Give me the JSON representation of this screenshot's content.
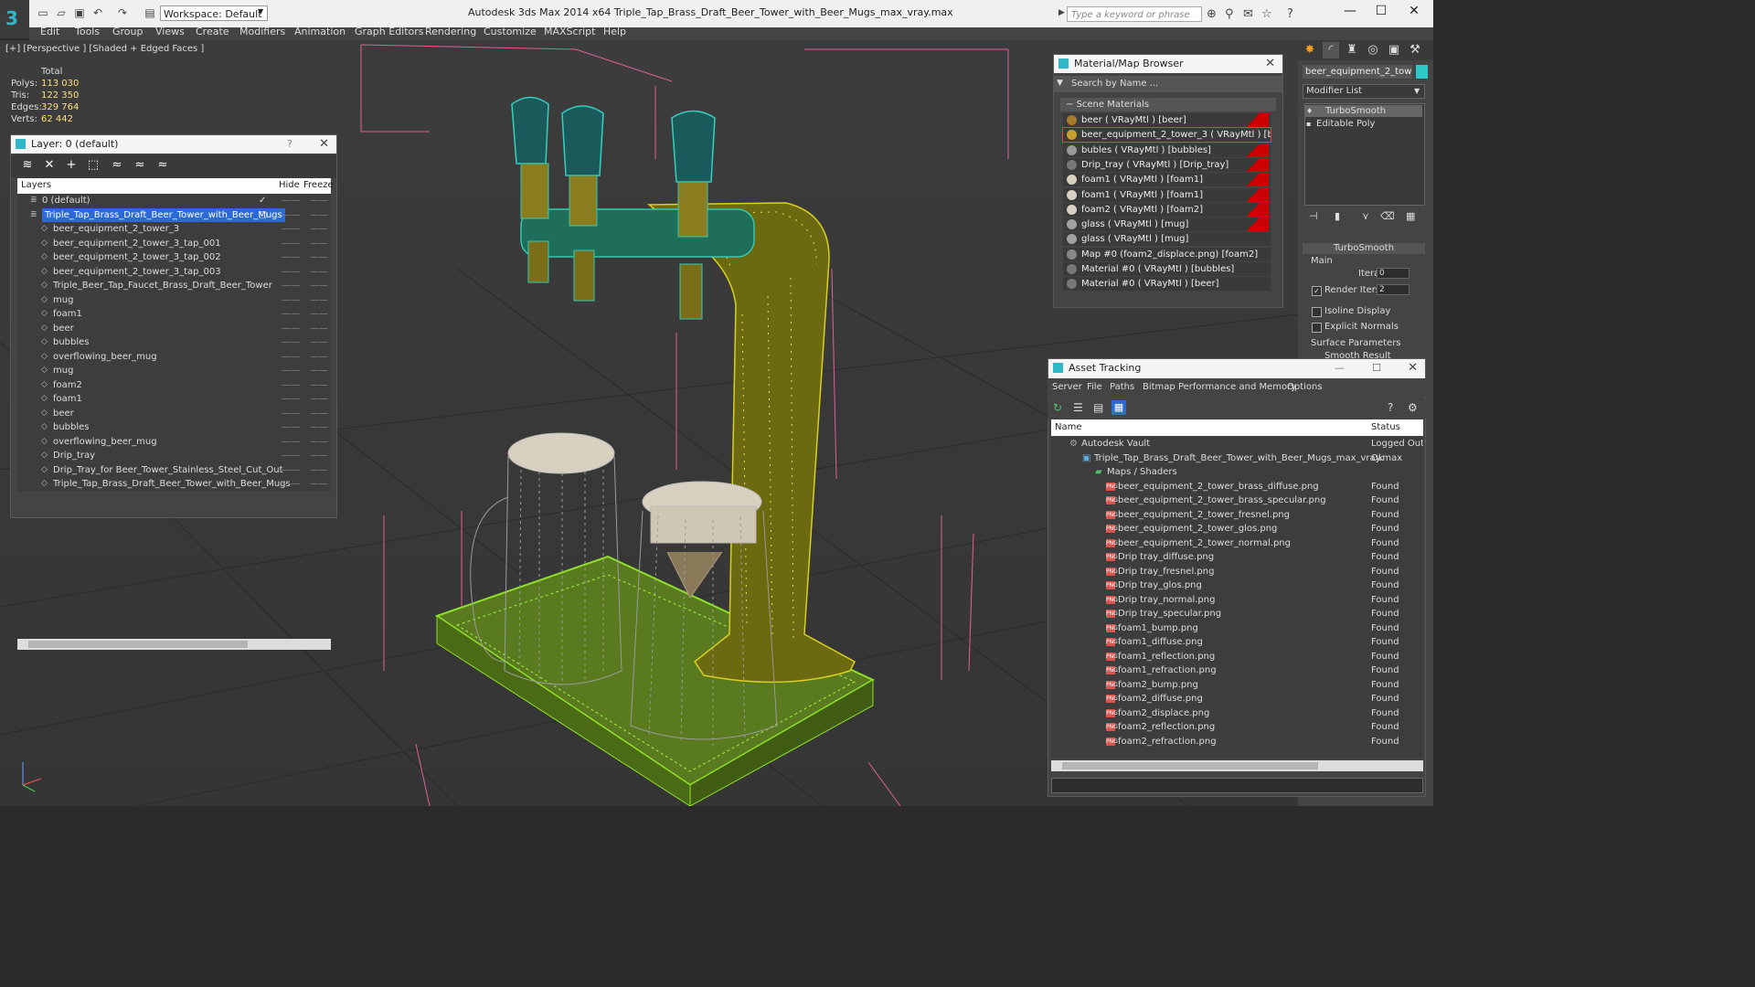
{
  "app": {
    "title": "Autodesk 3ds Max  2014 x64     Triple_Tap_Brass_Draft_Beer_Tower_with_Beer_Mugs_max_vray.max",
    "workspace": "Workspace: Default",
    "search_placeholder": "Type a keyword or phrase"
  },
  "menu": [
    "Edit",
    "Tools",
    "Group",
    "Views",
    "Create",
    "Modifiers",
    "Animation",
    "Graph Editors",
    "Rendering",
    "Customize",
    "MAXScript",
    "Help"
  ],
  "viewport": {
    "label": "[+] [Perspective ] [Shaded + Edged Faces ]",
    "stats": {
      "total_label": "Total",
      "rows": [
        {
          "label": "Polys:",
          "value": "113 030"
        },
        {
          "label": "Tris:",
          "value": "122 350"
        },
        {
          "label": "Edges:",
          "value": "329 764"
        },
        {
          "label": "Verts:",
          "value": "62 442"
        }
      ]
    }
  },
  "layer_panel": {
    "title": "Layer: 0 (default)",
    "help": "?",
    "columns": {
      "layers": "Layers",
      "hide": "Hide",
      "freeze": "Freeze"
    },
    "rows": [
      {
        "name": "0 (default)",
        "indent": 1,
        "selected": false,
        "check": "✓"
      },
      {
        "name": "Triple_Tap_Brass_Draft_Beer_Tower_with_Beer_Mugs",
        "indent": 1,
        "selected": true,
        "check": "▢"
      },
      {
        "name": "beer_equipment_2_tower_3",
        "indent": 2,
        "selected": false,
        "check": ""
      },
      {
        "name": "beer_equipment_2_tower_3_tap_001",
        "indent": 2,
        "selected": false,
        "check": ""
      },
      {
        "name": "beer_equipment_2_tower_3_tap_002",
        "indent": 2,
        "selected": false,
        "check": ""
      },
      {
        "name": "beer_equipment_2_tower_3_tap_003",
        "indent": 2,
        "selected": false,
        "check": ""
      },
      {
        "name": "Triple_Beer_Tap_Faucet_Brass_Draft_Beer_Tower",
        "indent": 2,
        "selected": false,
        "check": ""
      },
      {
        "name": "mug",
        "indent": 2,
        "selected": false,
        "check": ""
      },
      {
        "name": "foam1",
        "indent": 2,
        "selected": false,
        "check": ""
      },
      {
        "name": "beer",
        "indent": 2,
        "selected": false,
        "check": ""
      },
      {
        "name": "bubbles",
        "indent": 2,
        "selected": false,
        "check": ""
      },
      {
        "name": "overflowing_beer_mug",
        "indent": 2,
        "selected": false,
        "check": ""
      },
      {
        "name": "mug",
        "indent": 2,
        "selected": false,
        "check": ""
      },
      {
        "name": "foam2",
        "indent": 2,
        "selected": false,
        "check": ""
      },
      {
        "name": "foam1",
        "indent": 2,
        "selected": false,
        "check": ""
      },
      {
        "name": "beer",
        "indent": 2,
        "selected": false,
        "check": ""
      },
      {
        "name": "bubbles",
        "indent": 2,
        "selected": false,
        "check": ""
      },
      {
        "name": "overflowing_beer_mug",
        "indent": 2,
        "selected": false,
        "check": ""
      },
      {
        "name": "Drip_tray",
        "indent": 2,
        "selected": false,
        "check": ""
      },
      {
        "name": "Drip_Tray_for Beer_Tower_Stainless_Steel_Cut_Out",
        "indent": 2,
        "selected": false,
        "check": ""
      },
      {
        "name": "Triple_Tap_Brass_Draft_Beer_Tower_with_Beer_Mugs",
        "indent": 2,
        "selected": false,
        "check": ""
      }
    ]
  },
  "material_browser": {
    "title": "Material/Map Browser",
    "search_placeholder": "Search by Name ...",
    "section": "Scene Materials",
    "items": [
      {
        "label": "beer  ( VRayMtl ) [beer]",
        "flag": true,
        "selected": false,
        "swatch": "#a67a2a"
      },
      {
        "label": "beer_equipment_2_tower_3  ( VRayMtl ) [beer...",
        "flag": false,
        "selected": true,
        "swatch": "#c8a030"
      },
      {
        "label": "bubles  ( VRayMtl ) [bubbles]",
        "flag": true,
        "selected": false,
        "swatch": "#999999"
      },
      {
        "label": "Drip_tray  ( VRayMtl ) [Drip_tray]",
        "flag": true,
        "selected": false,
        "swatch": "#777777"
      },
      {
        "label": "foam1  ( VRayMtl ) [foam1]",
        "flag": true,
        "selected": false,
        "swatch": "#d8d0c0"
      },
      {
        "label": "foam1  ( VRayMtl ) [foam1]",
        "flag": true,
        "selected": false,
        "swatch": "#d8d0c0"
      },
      {
        "label": "foam2  ( VRayMtl ) [foam2]",
        "flag": true,
        "selected": false,
        "swatch": "#d8d0c0"
      },
      {
        "label": "glass  ( VRayMtl ) [mug]",
        "flag": true,
        "selected": false,
        "swatch": "#a0a0a0"
      },
      {
        "label": "glass  ( VRayMtl ) [mug]",
        "flag": false,
        "selected": false,
        "swatch": "#a0a0a0"
      },
      {
        "label": "Map #0 (foam2_displace.png) [foam2]",
        "flag": false,
        "selected": false,
        "swatch": "#888888"
      },
      {
        "label": "Material #0  ( VRayMtl ) [bubbles]",
        "flag": false,
        "selected": false,
        "swatch": "#777777"
      },
      {
        "label": "Material #0  ( VRayMtl ) [beer]",
        "flag": false,
        "selected": false,
        "swatch": "#777777"
      }
    ]
  },
  "command_panel": {
    "object_name": "beer_equipment_2_tower_3",
    "modifier_list": "Modifier List",
    "stack": [
      "TurboSmooth",
      "Editable Poly"
    ],
    "rollout_title": "TurboSmooth",
    "main_label": "Main",
    "iterations_label": "Iterations:",
    "iterations_value": "0",
    "render_iters_label": "Render Iters:",
    "render_iters_value": "2",
    "render_iters_checked": "✓",
    "isoline_label": "Isoline Display",
    "explicit_label": "Explicit Normals",
    "surface_label": "Surface Parameters",
    "smooth_label": "Smooth Result"
  },
  "asset_tracking": {
    "title": "Asset Tracking",
    "menu": [
      "Server",
      "File",
      "Paths",
      "Bitmap Performance and Memory",
      "Options"
    ],
    "columns": {
      "name": "Name",
      "status": "Status"
    },
    "rows": [
      {
        "name": "Autodesk Vault",
        "status": "Logged Out ...",
        "level": 0,
        "kind": "vault"
      },
      {
        "name": "Triple_Tap_Brass_Draft_Beer_Tower_with_Beer_Mugs_max_vray.max",
        "status": "Ok",
        "level": 1,
        "kind": "file"
      },
      {
        "name": "Maps / Shaders",
        "status": "",
        "level": 2,
        "kind": "folder"
      },
      {
        "name": "beer_equipment_2_tower_brass_diffuse.png",
        "status": "Found",
        "level": 3,
        "kind": "png"
      },
      {
        "name": "beer_equipment_2_tower_brass_specular.png",
        "status": "Found",
        "level": 3,
        "kind": "png"
      },
      {
        "name": "beer_equipment_2_tower_fresnel.png",
        "status": "Found",
        "level": 3,
        "kind": "png"
      },
      {
        "name": "beer_equipment_2_tower_glos.png",
        "status": "Found",
        "level": 3,
        "kind": "png"
      },
      {
        "name": "beer_equipment_2_tower_normal.png",
        "status": "Found",
        "level": 3,
        "kind": "png"
      },
      {
        "name": "Drip tray_diffuse.png",
        "status": "Found",
        "level": 3,
        "kind": "png"
      },
      {
        "name": "Drip tray_fresnel.png",
        "status": "Found",
        "level": 3,
        "kind": "png"
      },
      {
        "name": "Drip tray_glos.png",
        "status": "Found",
        "level": 3,
        "kind": "png"
      },
      {
        "name": "Drip tray_normal.png",
        "status": "Found",
        "level": 3,
        "kind": "png"
      },
      {
        "name": "Drip tray_specular.png",
        "status": "Found",
        "level": 3,
        "kind": "png"
      },
      {
        "name": "foam1_bump.png",
        "status": "Found",
        "level": 3,
        "kind": "png"
      },
      {
        "name": "foam1_diffuse.png",
        "status": "Found",
        "level": 3,
        "kind": "png"
      },
      {
        "name": "foam1_reflection.png",
        "status": "Found",
        "level": 3,
        "kind": "png"
      },
      {
        "name": "foam1_refraction.png",
        "status": "Found",
        "level": 3,
        "kind": "png"
      },
      {
        "name": "foam2_bump.png",
        "status": "Found",
        "level": 3,
        "kind": "png"
      },
      {
        "name": "foam2_diffuse.png",
        "status": "Found",
        "level": 3,
        "kind": "png"
      },
      {
        "name": "foam2_displace.png",
        "status": "Found",
        "level": 3,
        "kind": "png"
      },
      {
        "name": "foam2_reflection.png",
        "status": "Found",
        "level": 3,
        "kind": "png"
      },
      {
        "name": "foam2_refraction.png",
        "status": "Found",
        "level": 3,
        "kind": "png"
      }
    ]
  },
  "colors": {
    "accent": "#2fb8c8",
    "selection": "#2b69d4",
    "stat_value": "#ffe07a",
    "tower_yellow": "#c8c020",
    "tap_teal": "#2fa8a0",
    "tray_green": "#7ed321",
    "material_flag": "#cc0000"
  }
}
